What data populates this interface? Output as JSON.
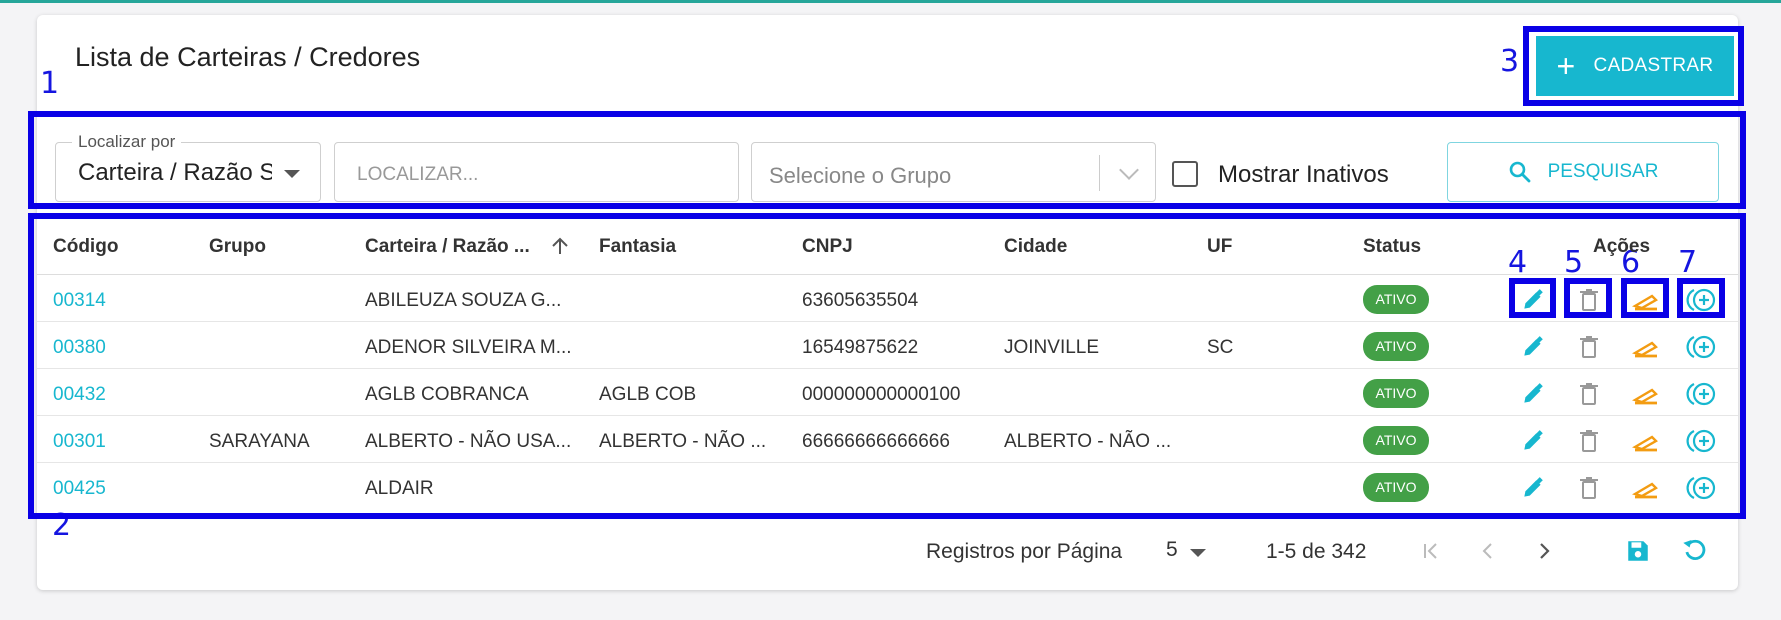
{
  "page": {
    "title": "Lista de Carteiras / Credores"
  },
  "annotations": [
    "1",
    "2",
    "3",
    "4",
    "5",
    "6",
    "7"
  ],
  "toolbar": {
    "cadastrar_label": "CADASTRAR"
  },
  "filters": {
    "localizar_por_legend": "Localizar por",
    "localizar_por_value": "Carteira / Razão Social",
    "search_placeholder": "LOCALIZAR...",
    "group_placeholder": "Selecione o Grupo",
    "show_inactive_label": "Mostrar Inativos",
    "pesquisar_label": "PESQUISAR"
  },
  "table": {
    "columns": [
      "Código",
      "Grupo",
      "Carteira / Razão ...",
      "Fantasia",
      "CNPJ",
      "Cidade",
      "UF",
      "Status",
      "Ações"
    ],
    "rows": [
      {
        "codigo": "00314",
        "grupo": "",
        "carteira": "ABILEUZA SOUZA G...",
        "fantasia": "",
        "cnpj": "63605635504",
        "cidade": "",
        "uf": "",
        "status": "ATIVO"
      },
      {
        "codigo": "00380",
        "grupo": "",
        "carteira": "ADENOR SILVEIRA M...",
        "fantasia": "",
        "cnpj": "16549875622",
        "cidade": "JOINVILLE",
        "uf": "SC",
        "status": "ATIVO"
      },
      {
        "codigo": "00432",
        "grupo": "",
        "carteira": "AGLB COBRANCA",
        "fantasia": "AGLB COB",
        "cnpj": "000000000000100",
        "cidade": "",
        "uf": "",
        "status": "ATIVO"
      },
      {
        "codigo": "00301",
        "grupo": "SARAYANA",
        "carteira": "ALBERTO - NÃO USA...",
        "fantasia": "ALBERTO - NÃO ...",
        "cnpj": "66666666666666",
        "cidade": "ALBERTO - NÃO ...",
        "uf": "",
        "status": "ATIVO"
      },
      {
        "codigo": "00425",
        "grupo": "",
        "carteira": "ALDAIR",
        "fantasia": "",
        "cnpj": "",
        "cidade": "",
        "uf": "",
        "status": "ATIVO"
      }
    ]
  },
  "footer": {
    "per_page_label": "Registros por Página",
    "per_page_value": "5",
    "range_label": "1-5 de 342"
  },
  "colors": {
    "accent": "#17b7cf",
    "status_active": "#43a047",
    "action_orange": "#f39c12",
    "annotation_blue": "#0a00e6"
  },
  "icons": [
    "plus-icon",
    "search-icon",
    "sort-arrow-up-icon",
    "edit-icon",
    "trash-icon",
    "ticket-icon",
    "add-circle-icon",
    "first-page-icon",
    "prev-page-icon",
    "next-page-icon",
    "save-icon",
    "refresh-icon"
  ]
}
